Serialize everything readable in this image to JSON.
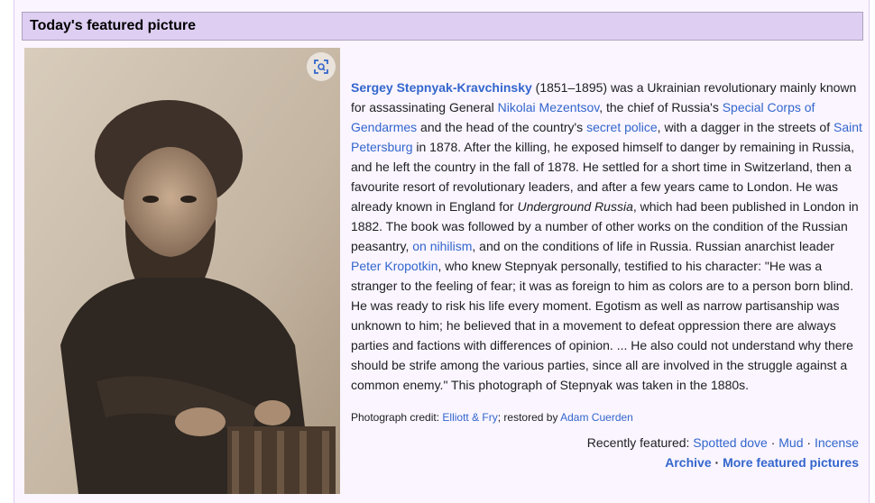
{
  "header": {
    "title": "Today's featured picture"
  },
  "image": {
    "zoom_icon": "zoom-icon"
  },
  "blurb": {
    "subject": "Sergey Stepnyak-Kravchinsky",
    "t1": " (1851–1895) was a Ukrainian revolutionary mainly known for assassinating General ",
    "link_mezentsov": "Nikolai Mezentsov",
    "t2": ", the chief of Russia's ",
    "link_corps": "Special Corps of Gendarmes",
    "t3": " and the head of the country's ",
    "link_police": "secret police",
    "t4": ", with a dagger in the streets of ",
    "link_stpete": "Saint Petersburg",
    "t5": " in 1878. After the killing, he exposed himself to danger by remaining in Russia, and he left the country in the fall of 1878. He settled for a short time in Switzerland, then a favourite resort of revolutionary leaders, and after a few years came to London. He was already known in England for ",
    "book": "Underground Russia",
    "t6": ", which had been published in London in 1882. The book was followed by a number of other works on the condition of the Russian peasantry, ",
    "link_nihilism": "on nihilism",
    "t7": ", and on the conditions of life in Russia. Russian anarchist leader ",
    "link_kropotkin": "Peter Kropotkin",
    "t8": ", who knew Stepnyak personally, testified to his character: \"He was a stranger to the feeling of fear; it was as foreign to him as colors are to a person born blind. He was ready to risk his life every moment. Egotism as well as narrow partisanship was unknown to him; he believed that in a movement to defeat oppression there are always parties and factions with differences of opinion. ... He also could not understand why there should be strife among the various parties, since all are involved in the struggle against a common enemy.\" This photograph of Stepnyak was taken in the 1880s."
  },
  "credit": {
    "label": "Photograph credit: ",
    "link_photographer": "Elliott & Fry",
    "sep": "; restored by ",
    "link_restorer": "Adam Cuerden"
  },
  "recent": {
    "label": "Recently featured: ",
    "items": [
      "Spotted dove",
      "Mud",
      "Incense"
    ],
    "dot": " · "
  },
  "footer": {
    "archive": "Archive",
    "more": "More featured pictures",
    "dot": " · "
  },
  "colors": {
    "link": "#3366cc",
    "header_bg": "#ddcef2",
    "panel_bg": "#faf5ff",
    "text": "#202122"
  }
}
